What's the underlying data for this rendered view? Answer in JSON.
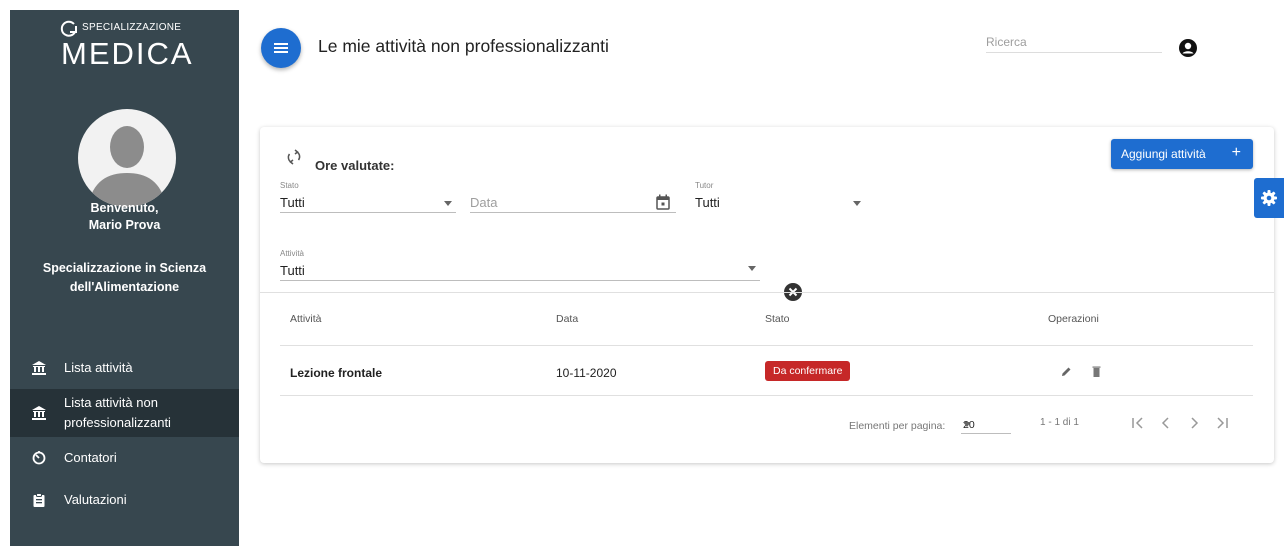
{
  "brand": {
    "small": "SPECIALIZZAZIONE",
    "big": "MEDICA"
  },
  "user": {
    "welcome_line1": "Benvenuto,",
    "welcome_line2": "Mario Prova",
    "specialization_line1": "Specializzazione in Scienza",
    "specialization_line2": "dell'Alimentazione"
  },
  "sidebar": {
    "items": [
      {
        "label": "Lista attività",
        "icon": "bank-icon",
        "active": false
      },
      {
        "label_line1": "Lista attività non",
        "label_line2": "professionalizzanti",
        "icon": "bank-icon",
        "active": true
      },
      {
        "label": "Contatori",
        "icon": "timer-icon",
        "active": false
      },
      {
        "label": "Valutazioni",
        "icon": "clipboard-icon",
        "active": false
      }
    ]
  },
  "header": {
    "title": "Le mie attività non professionalizzanti",
    "search_placeholder": "Ricerca"
  },
  "card": {
    "ore_label": "Ore valutate:",
    "add_button": "Aggiungi attività",
    "add_button_icon": "+",
    "filters": {
      "stato": {
        "label": "Stato",
        "value": "Tutti"
      },
      "data": {
        "placeholder": "Data"
      },
      "tutor": {
        "label": "Tutor",
        "value": "Tutti"
      },
      "attivita": {
        "label": "Attività",
        "value": "Tutti"
      }
    },
    "table": {
      "headers": [
        "Attività",
        "Data",
        "Stato",
        "Operazioni"
      ],
      "rows": [
        {
          "attivita": "Lezione frontale",
          "data": "10-11-2020",
          "stato": "Da confermare"
        }
      ]
    },
    "pagination": {
      "per_page_label": "Elementi per pagina:",
      "per_page_value": "20",
      "range": "1 - 1 di 1"
    }
  },
  "colors": {
    "sidebar_bg": "#37474f",
    "sidebar_active": "#263238",
    "primary": "#1e6dd0",
    "badge_red": "#c62828"
  }
}
